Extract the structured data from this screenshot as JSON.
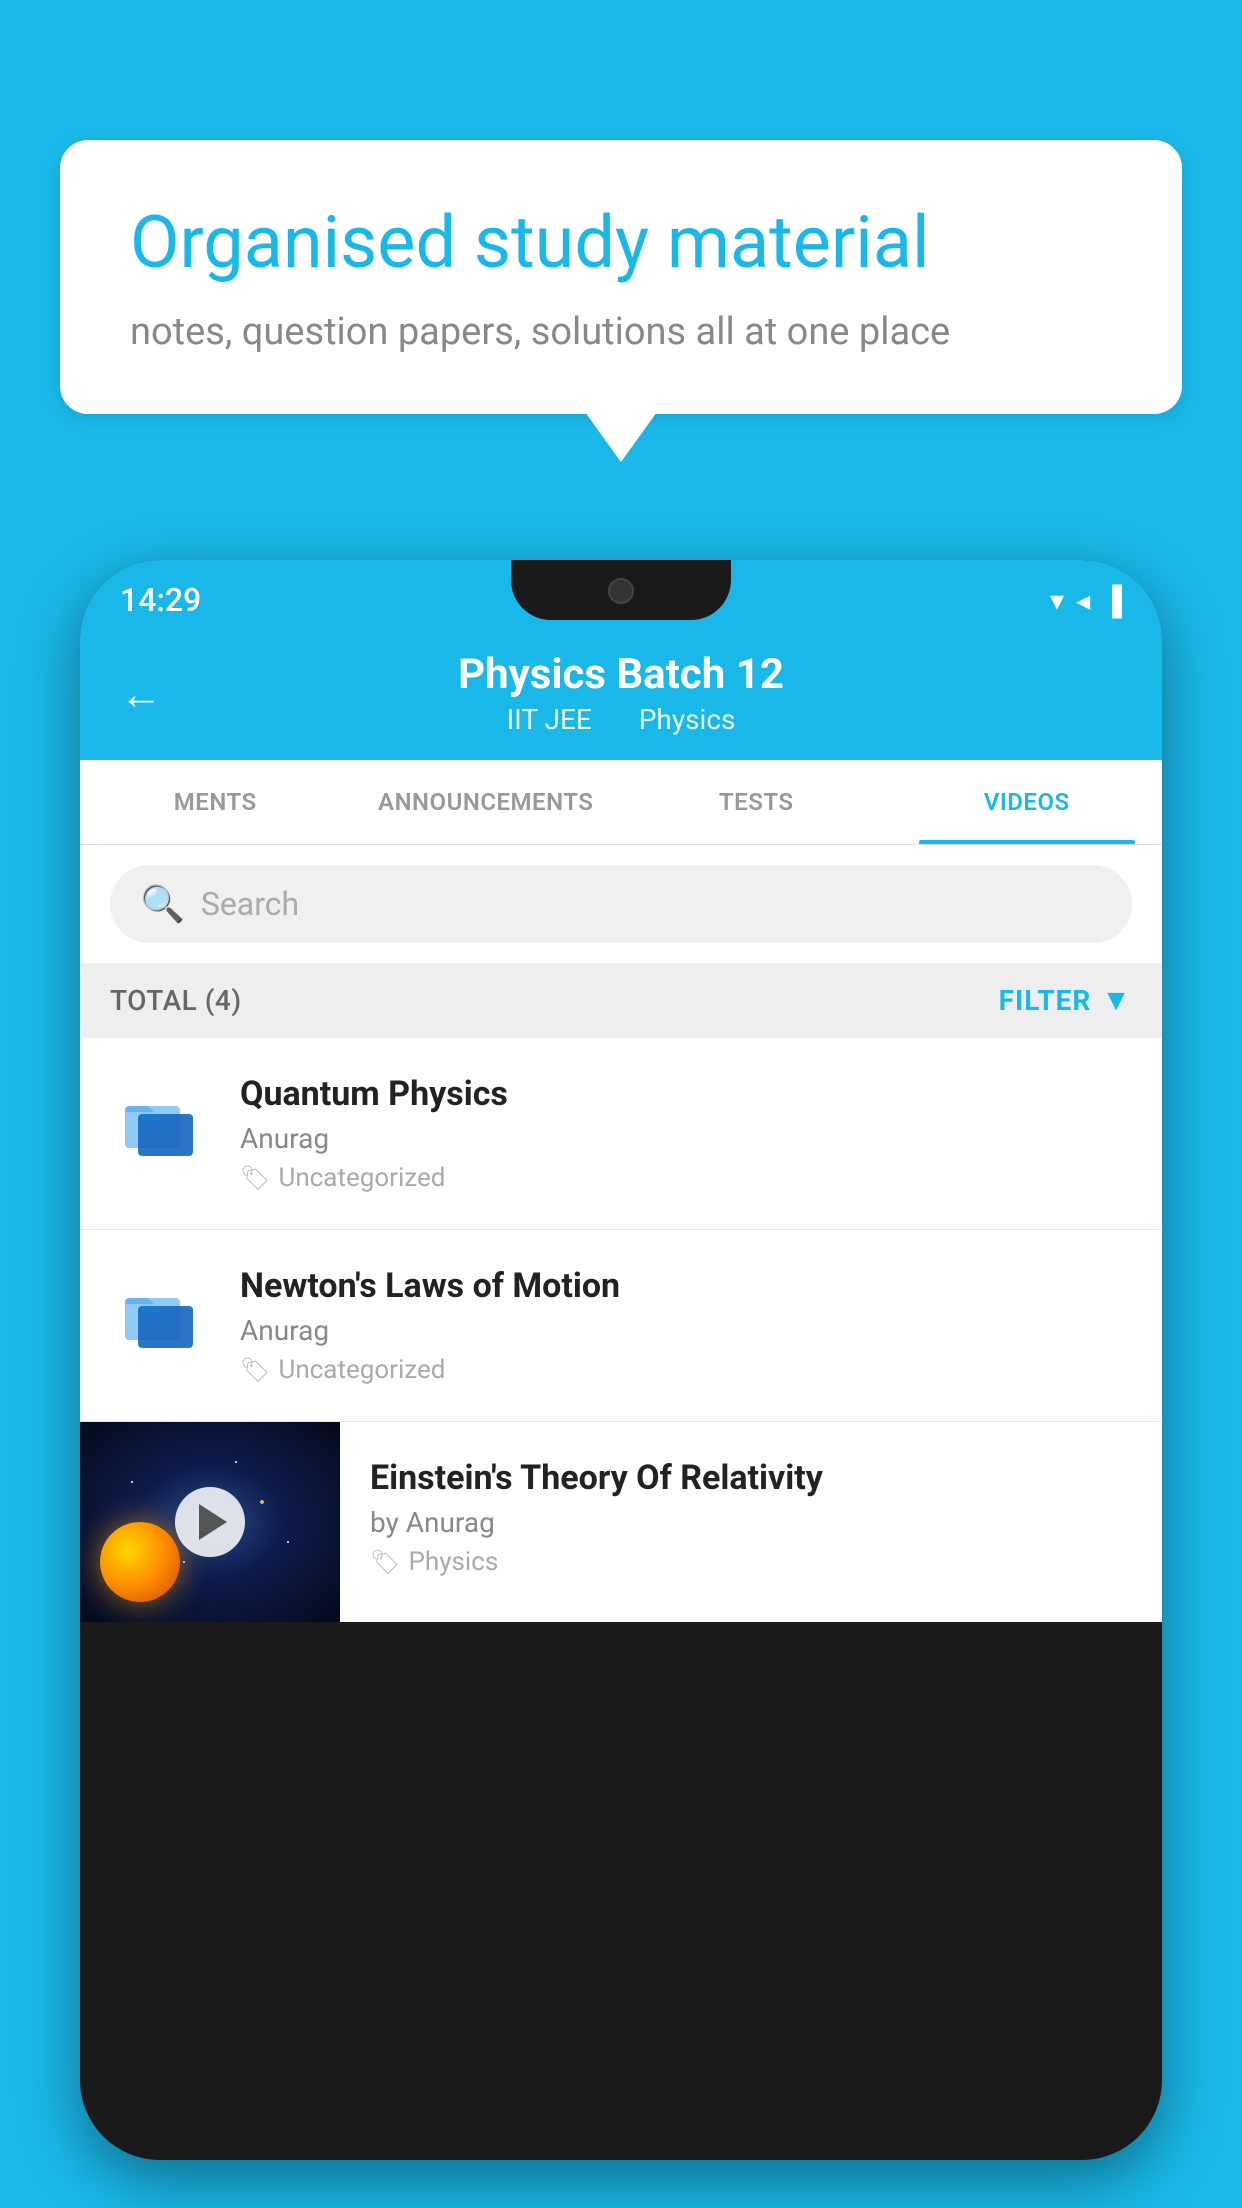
{
  "background_color": "#1ab8e8",
  "speech_bubble": {
    "title": "Organised study material",
    "subtitle": "notes, question papers, solutions all at one place"
  },
  "phone": {
    "status_bar": {
      "time": "14:29",
      "wifi": "▾",
      "signal": "▲",
      "battery": "▐"
    },
    "header": {
      "back_label": "←",
      "title": "Physics Batch 12",
      "subtitle_part1": "IIT JEE",
      "subtitle_part2": "Physics"
    },
    "tabs": [
      {
        "label": "MENTS",
        "active": false
      },
      {
        "label": "ANNOUNCEMENTS",
        "active": false
      },
      {
        "label": "TESTS",
        "active": false
      },
      {
        "label": "VIDEOS",
        "active": true
      }
    ],
    "search": {
      "placeholder": "Search"
    },
    "filter_bar": {
      "total_label": "TOTAL (4)",
      "filter_label": "FILTER"
    },
    "videos": [
      {
        "id": 1,
        "title": "Quantum Physics",
        "author": "Anurag",
        "tag": "Uncategorized",
        "has_thumbnail": false
      },
      {
        "id": 2,
        "title": "Newton's Laws of Motion",
        "author": "Anurag",
        "tag": "Uncategorized",
        "has_thumbnail": false
      },
      {
        "id": 3,
        "title": "Einstein's Theory Of Relativity",
        "author": "by Anurag",
        "tag": "Physics",
        "has_thumbnail": true
      }
    ]
  }
}
